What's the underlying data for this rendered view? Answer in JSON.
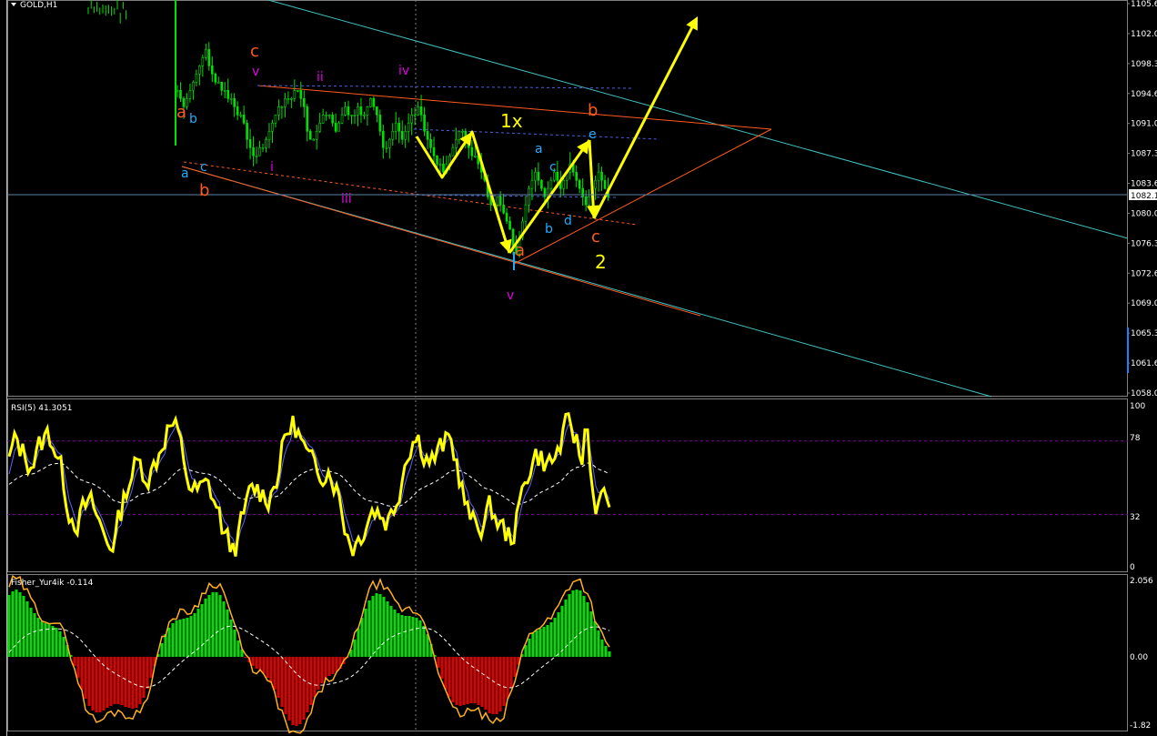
{
  "window": {
    "symbol_label": "GOLD,H1"
  },
  "main_panel": {
    "price_ticks": [
      "1105.6",
      "1102.0",
      "1098.3",
      "1094.6",
      "1091.0",
      "1087.3",
      "1083.6",
      "1080.0",
      "1076.3",
      "1072.6",
      "1069.0",
      "1065.3",
      "1061.6",
      "1058.0"
    ],
    "current_price": "1082.1",
    "wave_labels": {
      "orange": [
        "c",
        "a",
        "b",
        "b",
        "a",
        "c"
      ],
      "magenta": [
        "v",
        "ii",
        "iv",
        "i",
        "iii",
        "v"
      ],
      "cyan": [
        "b",
        "a",
        "c",
        "a",
        "c",
        "e",
        "b",
        "d"
      ],
      "yellow": [
        "1x",
        "2"
      ]
    }
  },
  "rsi_panel": {
    "label": "RSI(5) 41.3051",
    "ticks": [
      "100",
      "78",
      "32",
      "0"
    ]
  },
  "fisher_panel": {
    "label": "Fisher_Yur4ik -0.114",
    "ticks": [
      "2.056",
      "0.00",
      "-1.82"
    ]
  },
  "colors": {
    "candle": "#00e000",
    "orange": "#ff5a1e",
    "magenta": "#e000e0",
    "cyan": "#22aaff",
    "yellow": "#ffff00",
    "teal": "#40c0c0",
    "fisher_pos": "#00e000",
    "fisher_neg": "#e00000",
    "fisher_line": "#ffb020",
    "grid": "#808080"
  },
  "chart_data": {
    "type": "candlestick",
    "symbol": "GOLD",
    "timeframe": "H1",
    "ylim": [
      1058.0,
      1105.6
    ],
    "close_series": [
      1095,
      1094,
      1093,
      1094,
      1095,
      1096,
      1097,
      1098,
      1099,
      1100,
      1098,
      1097,
      1096,
      1096,
      1095,
      1095,
      1094,
      1094,
      1093,
      1092,
      1092,
      1091,
      1089,
      1088,
      1087,
      1087,
      1088,
      1088,
      1089,
      1090,
      1091,
      1092,
      1093,
      1093,
      1094,
      1094,
      1094,
      1095,
      1095,
      1094,
      1093,
      1090,
      1089,
      1089,
      1090,
      1091,
      1092,
      1092,
      1092,
      1091,
      1090,
      1091,
      1092,
      1093,
      1092,
      1092,
      1092,
      1093,
      1092,
      1092,
      1093,
      1094,
      1093,
      1092,
      1090,
      1088,
      1088,
      1089,
      1090,
      1091,
      1090,
      1089,
      1090,
      1091,
      1092,
      1092,
      1093,
      1092,
      1090,
      1089,
      1088,
      1087,
      1086,
      1086,
      1085,
      1086,
      1087,
      1088,
      1089,
      1090,
      1090,
      1089,
      1088,
      1087,
      1087,
      1086,
      1085,
      1084,
      1082,
      1081,
      1081,
      1082,
      1081,
      1080,
      1079,
      1078,
      1076,
      1075,
      1077,
      1079,
      1081,
      1083,
      1084,
      1085,
      1084,
      1083,
      1082,
      1083,
      1084,
      1085,
      1084,
      1083,
      1084,
      1085,
      1086,
      1085,
      1084,
      1083,
      1082,
      1081,
      1082,
      1083,
      1084,
      1085,
      1084,
      1083,
      1082
    ],
    "series": [
      {
        "name": "RSI(5)",
        "last": 41.3051
      },
      {
        "name": "Fisher_Yur4ik",
        "last": -0.114
      }
    ]
  }
}
